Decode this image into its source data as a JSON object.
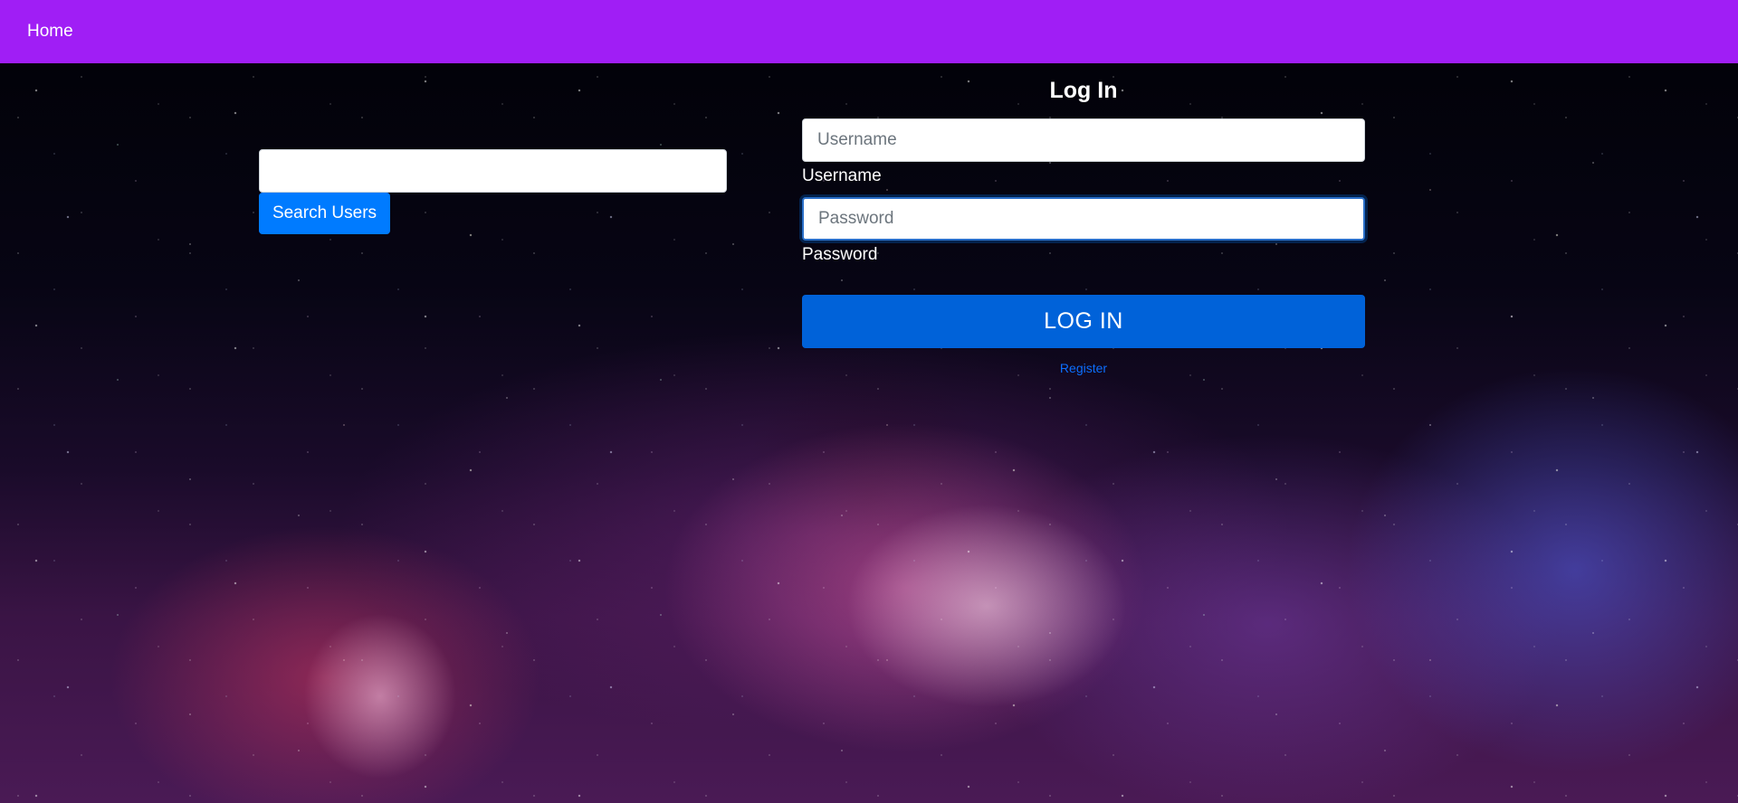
{
  "navbar": {
    "home_label": "Home",
    "background_color": "#a01ef5"
  },
  "search": {
    "input_value": "",
    "button_label": "Search Users"
  },
  "login": {
    "title": "Log In",
    "username": {
      "value": "",
      "placeholder": "Username",
      "label": "Username"
    },
    "password": {
      "value": "",
      "placeholder": "Password",
      "label": "Password",
      "focused": true
    },
    "submit_label": "LOG IN",
    "register_label": "Register"
  },
  "colors": {
    "primary_button": "#007bff",
    "login_button": "#0062d9",
    "link": "#0d6efd"
  }
}
